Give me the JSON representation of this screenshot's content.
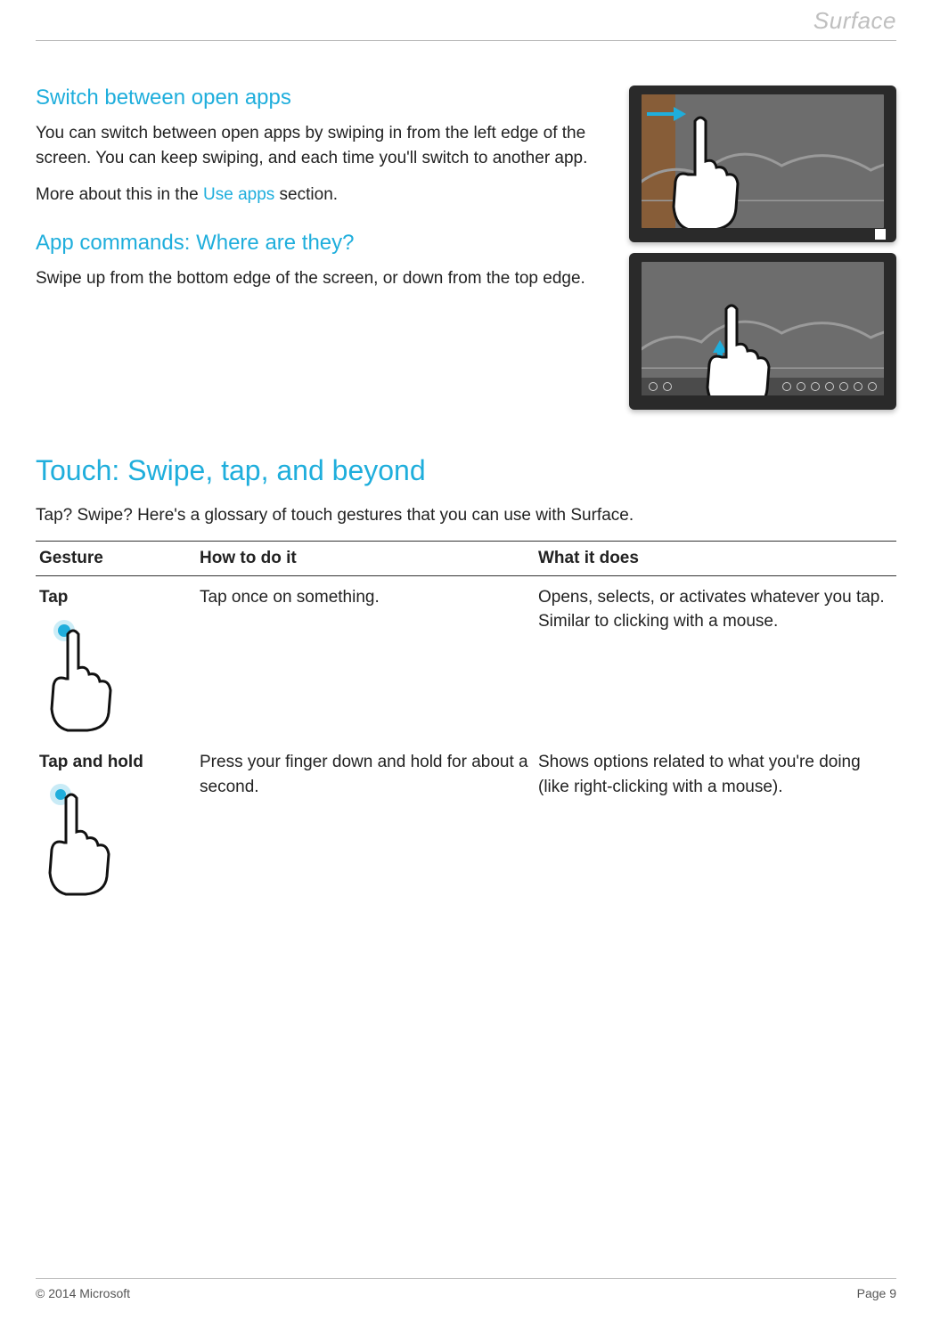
{
  "logo": "Surface",
  "sections": {
    "switch": {
      "title": "Switch between open apps",
      "body": "You can switch between open apps by swiping in from the left edge of the screen. You can keep swiping, and each time you'll switch to another app.",
      "more_prefix": "More about this in the ",
      "more_link": "Use apps",
      "more_suffix": " section."
    },
    "commands": {
      "title": "App commands: Where are they?",
      "body": "Swipe up from the bottom edge of the screen, or down from the top edge."
    },
    "touch": {
      "title": "Touch: Swipe, tap, and beyond",
      "intro": "Tap? Swipe? Here's a glossary of touch gestures that you can use with Surface."
    }
  },
  "table": {
    "headers": {
      "c1": "Gesture",
      "c2": "How to do it",
      "c3": "What it does"
    },
    "rows": [
      {
        "name": "Tap",
        "how": "Tap once on something.",
        "what": "Opens, selects, or activates whatever you tap. Similar to clicking with a mouse."
      },
      {
        "name": "Tap and hold",
        "how": "Press your finger down and hold for about a second.",
        "what": "Shows options related to what you're doing (like right-clicking with a mouse)."
      }
    ]
  },
  "footer": {
    "copyright": "© 2014 Microsoft",
    "page": "Page 9"
  }
}
